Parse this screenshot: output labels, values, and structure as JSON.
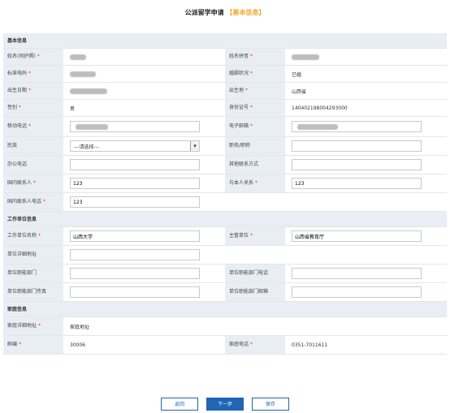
{
  "page": {
    "title": "公派留学申请",
    "title_sub": "【基本信息】"
  },
  "basic": {
    "section": "基本信息",
    "name_label": "姓名(同护照)",
    "name_cn_label": "姓名拼音",
    "id_label": "标准电码",
    "marital_label": "婚姻状况",
    "marital_value": "已婚",
    "birth_label": "出生日期",
    "birthplace_label": "出生地",
    "birthplace_value": "山西省",
    "gender_label": "性别",
    "gender_value": "男",
    "idno_label": "身份证号",
    "idno_value": "140402198004293000",
    "mobile_label": "移动电话",
    "email_label": "电子邮箱",
    "ethnic_label": "民族",
    "ethnic_select": "---请选择---",
    "title_label": "职务/职称",
    "office_phone_label": "办公电话",
    "other_contact_label": "其他联系方式",
    "domestic_contact_label": "国内联系人",
    "domestic_contact_value": "123",
    "relation_label": "与本人关系",
    "relation_value": "123",
    "domestic_phone_label": "国内联系人电话",
    "domestic_phone_value": "123",
    "required_mark": "*"
  },
  "work": {
    "section": "工作单位信息",
    "unit_name_label": "工作单位名称",
    "unit_name_value": "山西大学",
    "authority_label": "主管单位",
    "authority_value": "山西省教育厅",
    "unit_address_label": "单位详细地址",
    "dept_label": "单位职能部门",
    "dept_phone_label": "单位职能部门电话",
    "dept_fax_label": "单位职能部门传真",
    "dept_email_label": "单位职能部门邮箱"
  },
  "home": {
    "section": "家庭信息",
    "address_label": "家庭详细地址",
    "address_value": "家庭地址",
    "zip_label": "邮编",
    "zip_value": "30006",
    "phone_label": "家庭电话",
    "phone_value": "0351-7011611"
  },
  "buttons": {
    "back": "返回",
    "next": "下一步",
    "save": "保存"
  },
  "colors": {
    "accent": "#f5a623",
    "primary": "#1f66b5",
    "label_bg": "#e9eef4",
    "required": "#e53935"
  }
}
